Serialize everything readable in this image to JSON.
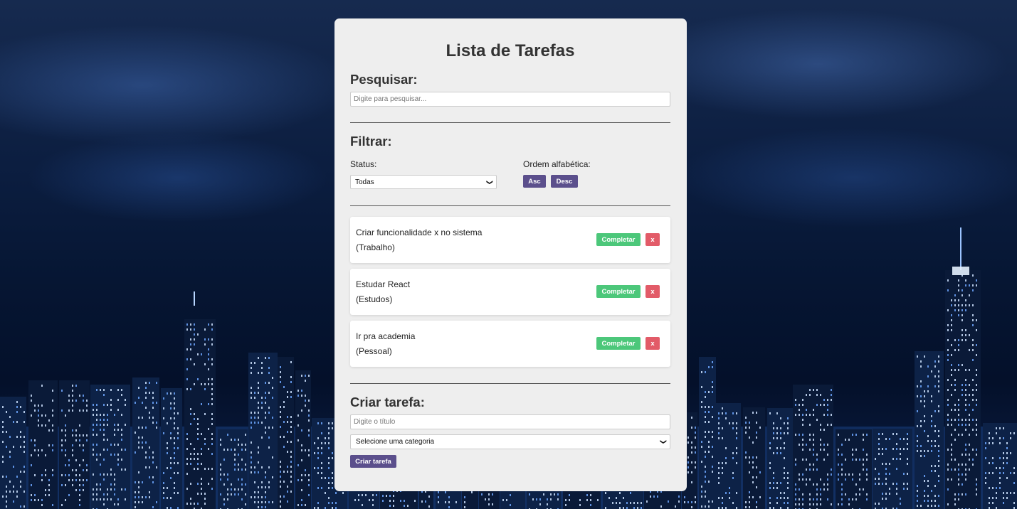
{
  "app": {
    "title": "Lista de Tarefas"
  },
  "search": {
    "heading": "Pesquisar:",
    "placeholder": "Digite para pesquisar...",
    "value": ""
  },
  "filter": {
    "heading": "Filtrar:",
    "status_label": "Status:",
    "status_selected": "Todas",
    "order_label": "Ordem alfabética:",
    "asc_label": "Asc",
    "desc_label": "Desc"
  },
  "tasks": [
    {
      "title": "Criar funcionalidade x no sistema",
      "category": "(Trabalho)",
      "complete_label": "Completar",
      "remove_label": "x"
    },
    {
      "title": "Estudar React",
      "category": "(Estudos)",
      "complete_label": "Completar",
      "remove_label": "x"
    },
    {
      "title": "Ir pra academia",
      "category": "(Pessoal)",
      "complete_label": "Completar",
      "remove_label": "x"
    }
  ],
  "create": {
    "heading": "Criar tarefa:",
    "title_placeholder": "Digite o título",
    "category_selected": "Selecione uma categoria",
    "submit_label": "Criar tarefa"
  },
  "colors": {
    "panel_bg": "#eeeeee",
    "accent_purple": "#5b4f8c",
    "complete_green": "#4cc77a",
    "remove_red": "#e25b68"
  }
}
